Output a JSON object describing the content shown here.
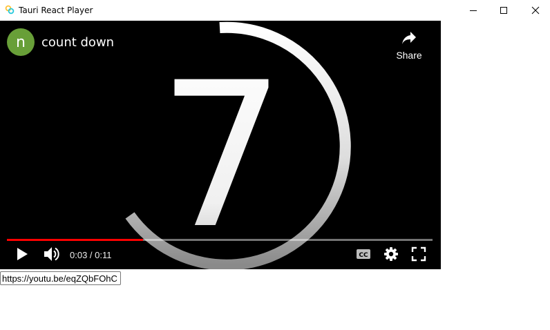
{
  "window": {
    "title": "Tauri React Player",
    "icons": {
      "app": "tauri-icon",
      "minimize": "minimize-icon",
      "maximize": "maximize-icon",
      "close": "close-icon"
    }
  },
  "player": {
    "channel_initial": "n",
    "title": "count down",
    "share_label": "Share",
    "time_text": "0:03 / 0:11",
    "progress_fraction": 0.32,
    "countdown_digit": "7",
    "colors": {
      "avatar": "#689f38",
      "progress": "#ff0000"
    },
    "icons": [
      "share-icon",
      "play-icon",
      "volume-icon",
      "closed-captions-icon",
      "settings-icon",
      "fullscreen-icon"
    ]
  },
  "url_input": {
    "value": "https://youtu.be/eqZQbFOhC"
  }
}
